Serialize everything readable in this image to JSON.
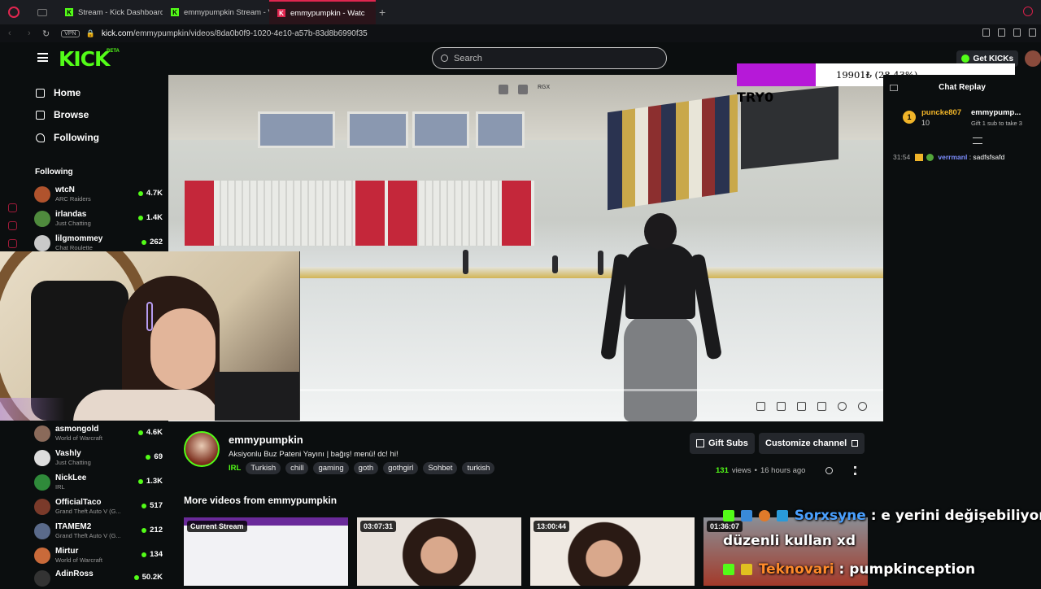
{
  "browser": {
    "tabs": [
      {
        "label": "Stream - Kick Dashboard"
      },
      {
        "label": "emmypumpkin Stream - V"
      },
      {
        "label": "emmypumpkin - Watc"
      }
    ],
    "vpn_label": "VPN",
    "url_host": "kick.com",
    "url_path": "/emmypumpkin/videos/8da0b0f9-1020-4e10-a57b-83d8b6990f35",
    "new_tab": "+"
  },
  "header": {
    "logo": "KICK",
    "beta": "BETA",
    "search_placeholder": "Search",
    "get_kicks": "Get KICKs"
  },
  "sidebar": {
    "nav": [
      {
        "label": "Home",
        "icon": "home-icon"
      },
      {
        "label": "Browse",
        "icon": "browse-icon"
      },
      {
        "label": "Following",
        "icon": "heart-icon"
      }
    ],
    "following_title": "Following",
    "channels_top": [
      {
        "name": "wtcN",
        "category": "ARC Raiders",
        "viewers": "4.7K",
        "color": "#b0532d"
      },
      {
        "name": "irlandas",
        "category": "Just Chatting",
        "viewers": "1.4K",
        "color": "#4f8a3d"
      },
      {
        "name": "lilgmommey",
        "category": "Chat Roulette",
        "viewers": "262",
        "color": "#c9c9c9"
      }
    ],
    "channels_bottom": [
      {
        "name": "asmongold",
        "category": "World of Warcraft",
        "viewers": "4.6K",
        "color": "#8a6a5a"
      },
      {
        "name": "Vashly",
        "category": "Just Chatting",
        "viewers": "69",
        "color": "#ddd"
      },
      {
        "name": "NickLee",
        "category": "IRL",
        "viewers": "1.3K",
        "color": "#2f8a3a"
      },
      {
        "name": "OfficialTaco",
        "category": "Grand Theft Auto V (G...",
        "viewers": "517",
        "color": "#7a3a2a"
      },
      {
        "name": "ITAMEM2",
        "category": "Grand Theft Auto V (G...",
        "viewers": "212",
        "color": "#5a6a8a"
      },
      {
        "name": "Mirtur",
        "category": "World of Warcraft",
        "viewers": "134",
        "color": "#c96a3a"
      },
      {
        "name": "AdinRoss",
        "category": "",
        "viewers": "50.2K",
        "color": "#333"
      }
    ]
  },
  "player": {
    "rgx_label": "RGX"
  },
  "goal": {
    "text": "19901₺ (28.43%)",
    "progress_fraction": 0.2843,
    "fill_color": "#b619d8",
    "label": "TRY0"
  },
  "chat": {
    "title": "Chat Replay",
    "pinned": {
      "badge": "1",
      "user": "puncke807",
      "count": "10",
      "user2": "emmypump...",
      "sub_text": "Gift 1 sub to take 3"
    },
    "message": {
      "time": "31:54",
      "user": "verrmanl",
      "text": ": sadfsfsafd"
    }
  },
  "video_info": {
    "streamer": "emmypumpkin",
    "title": "Aksiyonlu Buz Pateni Yayını | bağış! menü! dc! hi!",
    "category": "IRL",
    "tags": [
      "Turkish",
      "chill",
      "gaming",
      "goth",
      "gothgirl",
      "Sohbet",
      "turkish"
    ],
    "gift_subs": "Gift Subs",
    "customize": "Customize channel",
    "views_count": "131",
    "views_label": "views",
    "dot": "•",
    "age": "16 hours ago"
  },
  "more_videos": {
    "title": "More videos from emmypumpkin",
    "thumbs": [
      {
        "label": "Current Stream"
      },
      {
        "label": "03:07:31"
      },
      {
        "label": "13:00:44"
      },
      {
        "label": "01:36:07"
      }
    ]
  },
  "overlay_chat": [
    {
      "user": "Sorxsyne",
      "text": " : e yerini değişebiliyon"
    },
    {
      "user": "",
      "text": "düzenli kullan xd"
    },
    {
      "user": "Teknovari",
      "text": " : pumpkinception"
    }
  ]
}
